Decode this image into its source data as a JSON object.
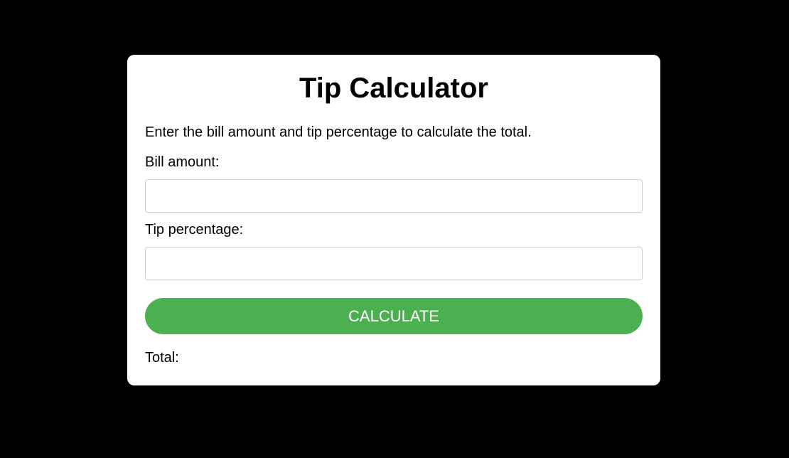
{
  "app": {
    "title": "Tip Calculator",
    "description": "Enter the bill amount and tip percentage to calculate the total."
  },
  "form": {
    "bill_label": "Bill amount:",
    "bill_value": "",
    "bill_placeholder": "",
    "tip_label": "Tip percentage:",
    "tip_value": "",
    "tip_placeholder": "",
    "calculate_label": "CALCULATE"
  },
  "result": {
    "total_label": "Total:"
  },
  "colors": {
    "background": "#000000",
    "card": "#ffffff",
    "button": "#4caf50",
    "button_text": "#ffffff",
    "field_border": "#cccccc"
  }
}
